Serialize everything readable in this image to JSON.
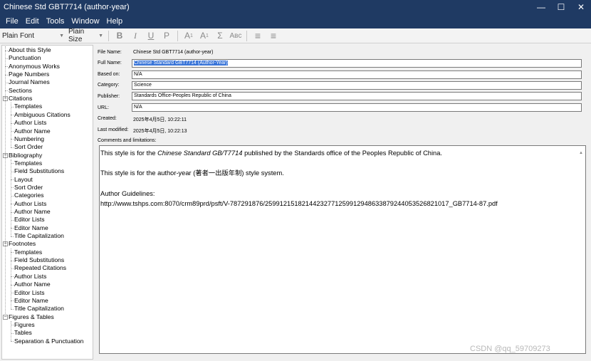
{
  "window": {
    "title": "Chinese Std GBT7714 (author-year)",
    "controls": {
      "minimize": "—",
      "maximize": "☐",
      "close": "✕"
    }
  },
  "menu": [
    "File",
    "Edit",
    "Tools",
    "Window",
    "Help"
  ],
  "toolbar": {
    "font": "Plain Font",
    "size": "Plain Size",
    "buttons": [
      {
        "name": "bold",
        "glyph": "B"
      },
      {
        "name": "italic",
        "glyph": "I"
      },
      {
        "name": "underline",
        "glyph": "U"
      },
      {
        "name": "plain",
        "glyph": "P"
      },
      {
        "name": "superscript",
        "glyph": "A",
        "mark": "1"
      },
      {
        "name": "subscript",
        "glyph": "A",
        "mark": "1"
      },
      {
        "name": "symbol",
        "glyph": "Σ"
      },
      {
        "name": "small-caps",
        "glyph": "Aʙᴄ"
      },
      {
        "name": "align-left",
        "glyph": "≡"
      },
      {
        "name": "align-center",
        "glyph": "≡"
      }
    ]
  },
  "tree": [
    {
      "label": "About this Style",
      "level": 0
    },
    {
      "label": "Punctuation",
      "level": 0
    },
    {
      "label": "Anonymous Works",
      "level": 0
    },
    {
      "label": "Page Numbers",
      "level": 0
    },
    {
      "label": "Journal Names",
      "level": 0
    },
    {
      "label": "Sections",
      "level": 0
    },
    {
      "label": "Citations",
      "level": 0,
      "expanded": true
    },
    {
      "label": "Templates",
      "level": 1
    },
    {
      "label": "Ambiguous Citations",
      "level": 1
    },
    {
      "label": "Author Lists",
      "level": 1
    },
    {
      "label": "Author Name",
      "level": 1
    },
    {
      "label": "Numbering",
      "level": 1
    },
    {
      "label": "Sort Order",
      "level": 1
    },
    {
      "label": "Bibliography",
      "level": 0,
      "expanded": true
    },
    {
      "label": "Templates",
      "level": 1
    },
    {
      "label": "Field Substitutions",
      "level": 1
    },
    {
      "label": "Layout",
      "level": 1
    },
    {
      "label": "Sort Order",
      "level": 1
    },
    {
      "label": "Categories",
      "level": 1
    },
    {
      "label": "Author Lists",
      "level": 1
    },
    {
      "label": "Author Name",
      "level": 1
    },
    {
      "label": "Editor Lists",
      "level": 1
    },
    {
      "label": "Editor Name",
      "level": 1
    },
    {
      "label": "Title Capitalization",
      "level": 1
    },
    {
      "label": "Footnotes",
      "level": 0,
      "expanded": true
    },
    {
      "label": "Templates",
      "level": 1
    },
    {
      "label": "Field Substitutions",
      "level": 1
    },
    {
      "label": "Repeated Citations",
      "level": 1
    },
    {
      "label": "Author Lists",
      "level": 1
    },
    {
      "label": "Author Name",
      "level": 1
    },
    {
      "label": "Editor Lists",
      "level": 1
    },
    {
      "label": "Editor Name",
      "level": 1
    },
    {
      "label": "Title Capitalization",
      "level": 1
    },
    {
      "label": "Figures & Tables",
      "level": 0,
      "expanded": true
    },
    {
      "label": "Figures",
      "level": 1
    },
    {
      "label": "Tables",
      "level": 1
    },
    {
      "label": "Separation & Punctuation",
      "level": 1
    }
  ],
  "fields": {
    "file_name": {
      "label": "File Name:",
      "value": "Chinese Std GBT7714 (author-year)"
    },
    "full_name": {
      "label": "Full Name:",
      "value": "Chinese Standard GBT7714 (Author-Year)"
    },
    "based_on": {
      "label": "Based on:",
      "value": "N/A"
    },
    "category": {
      "label": "Category:",
      "value": "Science"
    },
    "publisher": {
      "label": "Publisher:",
      "value": "Standards Office-Peoples Republic of China"
    },
    "url": {
      "label": "URL:",
      "value": "N/A"
    },
    "created": {
      "label": "Created:",
      "value": "2025年4月5日, 10:22:11"
    },
    "last_modified": {
      "label": "Last modified:",
      "value": "2025年4月5日, 10:22:13"
    },
    "comments_label": "Comments and limitations:"
  },
  "comments": {
    "line1_pre": "This style is for the ",
    "line1_italic": "Chinese Standard GB/T7714",
    "line1_post": "  published by the Standards office of the Peoples Republic of China.",
    "line2": "This style is for the author-year (著者一出版年制) style system.",
    "line3": "Author Guidelines:",
    "line4": "http://www.tshps.com:8070/crm89prd/psft/V-787291876/25991215182144232771259912948633879244053526821017_GB7714-87.pdf"
  },
  "watermark": "CSDN @qq_59709273"
}
